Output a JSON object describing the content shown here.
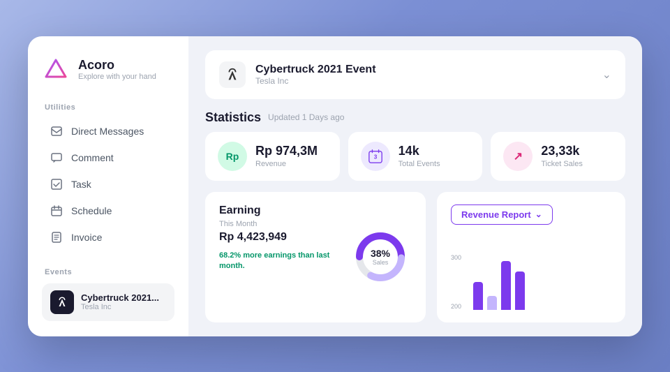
{
  "app": {
    "title": "Acoro",
    "subtitle": "Explore with your hand"
  },
  "sidebar": {
    "utilities_label": "Utilities",
    "events_label": "Events",
    "nav_items": [
      {
        "id": "direct-messages",
        "label": "Direct Messages",
        "icon": "✉"
      },
      {
        "id": "comment",
        "label": "Comment",
        "icon": "💬"
      },
      {
        "id": "task",
        "label": "Task",
        "icon": "☑"
      },
      {
        "id": "schedule",
        "label": "Schedule",
        "icon": "📅"
      },
      {
        "id": "invoice",
        "label": "Invoice",
        "icon": "📄"
      }
    ],
    "event_item": {
      "name": "Cybertruck 2021...",
      "company": "Tesla Inc"
    }
  },
  "header": {
    "event_name": "Cybertruck 2021 Event",
    "event_company": "Tesla Inc",
    "chevron": "⌄"
  },
  "statistics": {
    "title": "Statistics",
    "updated": "Updated 1 Days ago",
    "cards": [
      {
        "id": "revenue",
        "icon_label": "Rp",
        "value": "Rp 974,3M",
        "label": "Revenue",
        "icon_type": "green"
      },
      {
        "id": "total-events",
        "icon_label": "3",
        "value": "14k",
        "label": "Total Events",
        "icon_type": "purple"
      },
      {
        "id": "ticket-sales",
        "icon_label": "↗",
        "value": "23,33k",
        "label": "Ticket Sales",
        "icon_type": "pink"
      }
    ]
  },
  "earning": {
    "title": "Earning",
    "period": "This Month",
    "amount": "Rp 4,423,949",
    "note_highlight": "68.2%",
    "note_rest": " more earnings than last month.",
    "donut_percent": "38%",
    "donut_label": "Sales"
  },
  "revenue_report": {
    "button_label": "Revenue Report",
    "chevron": "⌄",
    "y_labels": [
      "300",
      "200"
    ],
    "bars": [
      {
        "height": 40,
        "light": false
      },
      {
        "height": 20,
        "light": true
      },
      {
        "height": 70,
        "light": false
      },
      {
        "height": 55,
        "light": false
      }
    ]
  }
}
